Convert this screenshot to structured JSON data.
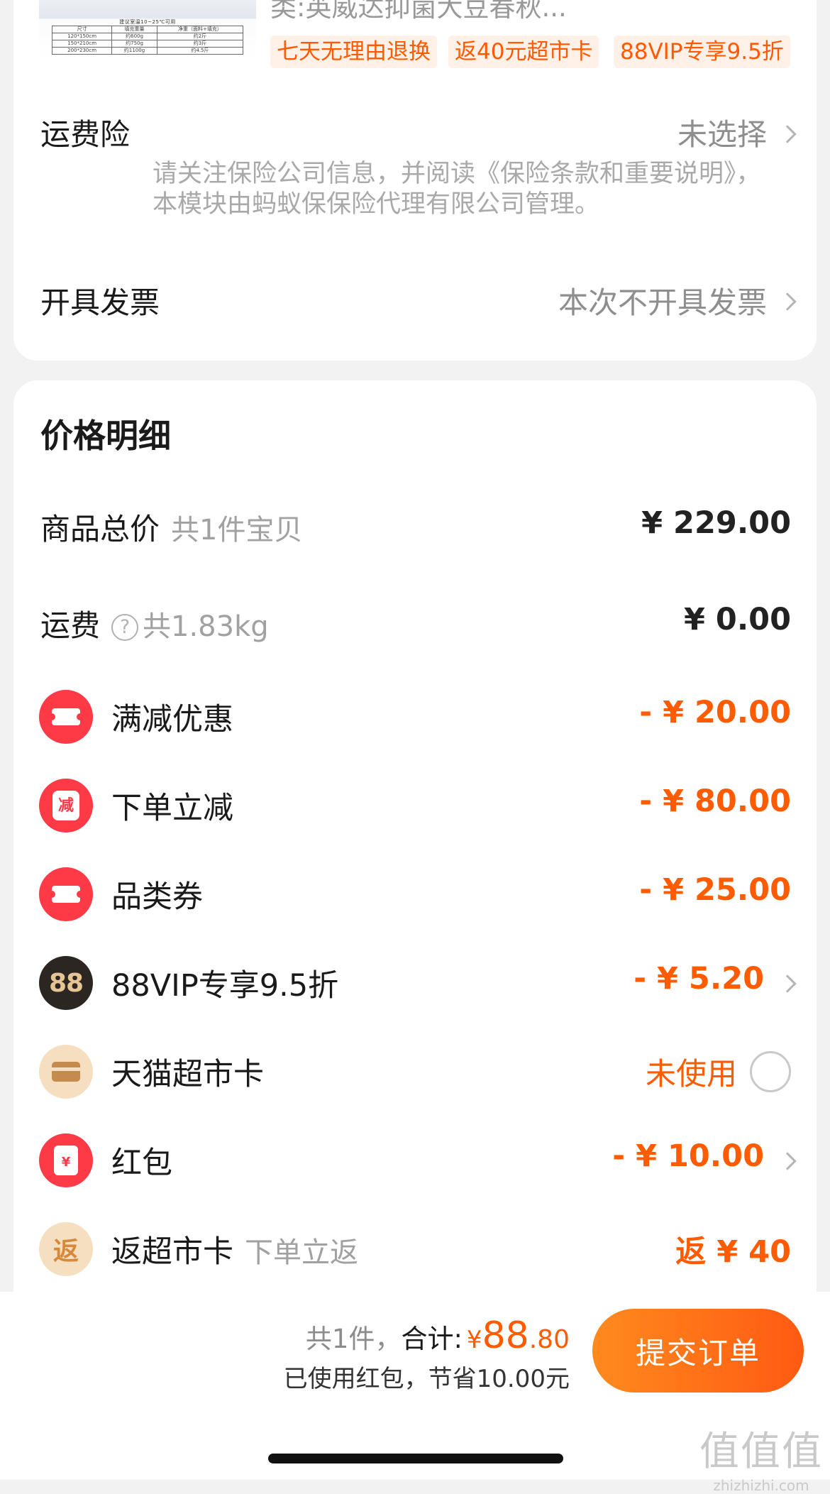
{
  "product": {
    "title_partial": "类:英威达抑菌大豆春秋...",
    "tags": [
      "七天无理由退换",
      "返40元超市卡",
      "88VIP专享9.5折"
    ],
    "thumbnail": {
      "spec_title": "建议室温10~25℃可用",
      "spec_table": [
        [
          "尺寸",
          "填充重量",
          "净重（面料+填充）"
        ],
        [
          "120*150cm",
          "约600g",
          "约2斤"
        ],
        [
          "150*210cm",
          "约750g",
          "约3斤"
        ],
        [
          "200*230cm",
          "约1100g",
          "约4.5斤"
        ]
      ]
    }
  },
  "shipping_insurance": {
    "label": "运费险",
    "value": "未选择",
    "note": "请关注保险公司信息，并阅读《保险条款和重要说明》，本模块由蚂蚁保保险代理有限公司管理。"
  },
  "invoice": {
    "label": "开具发票",
    "value": "本次不开具发票"
  },
  "price_detail": {
    "title": "价格明细",
    "goods_total": {
      "label": "商品总价",
      "sub": "共1件宝贝",
      "amount": "¥ 229.00"
    },
    "freight": {
      "label": "运费",
      "help": "?",
      "weight": "共1.83kg",
      "amount": "¥ 0.00"
    },
    "discounts": [
      {
        "label": "满减优惠",
        "amount": "- ¥ 20.00",
        "icon": "coupon-ticket-icon"
      },
      {
        "label": "下单立减",
        "amount": "- ¥ 80.00",
        "icon": "instant-discount-icon",
        "icon_text": "减"
      },
      {
        "label": "品类券",
        "amount": "- ¥ 25.00",
        "icon": "coupon-ticket-icon"
      },
      {
        "label": "88VIP专享9.5折",
        "amount": "- ¥ 5.20",
        "icon": "88vip-icon",
        "icon_text": "88"
      },
      {
        "label": "天猫超市卡",
        "amount": "未使用",
        "icon": "supermarket-card-icon"
      },
      {
        "label": "红包",
        "amount": "- ¥ 10.00",
        "icon": "red-packet-icon",
        "icon_text": "¥"
      },
      {
        "label": "返超市卡",
        "sub": "下单立返",
        "amount": "返 ¥ 40",
        "icon": "cashback-icon",
        "icon_text": "返"
      }
    ]
  },
  "footer": {
    "count": "共1件，",
    "total_label": "合计:",
    "currency": "¥",
    "total_int": "88",
    "total_dec": ".80",
    "saved": "已使用红包，节省10.00元",
    "submit": "提交订单"
  },
  "watermark": {
    "logo": "值值值",
    "url": "zhizhizhi.com"
  },
  "colors": {
    "accent": "#ff5b00",
    "icon_red": "#ff3a47",
    "vip_dark": "#2c2623",
    "beige": "#f6dfc1"
  }
}
